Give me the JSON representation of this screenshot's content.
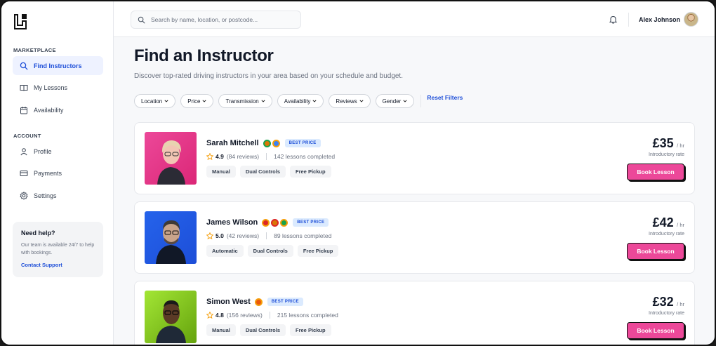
{
  "sidebar": {
    "sections": [
      {
        "label": "MARKETPLACE"
      },
      {
        "label": "ACCOUNT"
      }
    ],
    "items": [
      {
        "label": "Find Instructors",
        "icon": "search-icon",
        "active": true
      },
      {
        "label": "My Lessons",
        "icon": "book-icon"
      },
      {
        "label": "Availability",
        "icon": "calendar-icon"
      },
      {
        "label": "Profile",
        "icon": "user-icon"
      },
      {
        "label": "Payments",
        "icon": "credit-card-icon"
      },
      {
        "label": "Settings",
        "icon": "gear-icon"
      }
    ],
    "help": {
      "title": "Need help?",
      "text": "Our team is available 24/7 to help with bookings.",
      "link": "Contact Support"
    }
  },
  "topbar": {
    "search_placeholder": "Search by name, location, or postcode...",
    "user_name": "Alex Johnson"
  },
  "main": {
    "title": "Find an Instructor",
    "subtitle": "Discover top-rated driving instructors in your area based on your schedule and budget.",
    "filters": [
      "Location",
      "Price",
      "Transmission",
      "Availability",
      "Reviews",
      "Gender"
    ],
    "reset_label": "Reset Filters"
  },
  "instructors": [
    {
      "name": "Sarah Mitchell",
      "badge": "BEST PRICE",
      "rating": "4.9",
      "reviews": "(84 reviews)",
      "lessons": "142 lessons completed",
      "tags": [
        "Manual",
        "Dual Controls",
        "Free Pickup"
      ],
      "price": "£35",
      "unit": "/ hr",
      "price_note": "Introductory rate",
      "book_label": "Book Lesson"
    },
    {
      "name": "James Wilson",
      "badge": "BEST PRICE",
      "rating": "5.0",
      "reviews": "(42 reviews)",
      "lessons": "89 lessons completed",
      "tags": [
        "Automatic",
        "Dual Controls",
        "Free Pickup"
      ],
      "price": "£42",
      "unit": "/ hr",
      "price_note": "Introductory rate",
      "book_label": "Book Lesson"
    },
    {
      "name": "Simon West",
      "badge": "BEST PRICE",
      "rating": "4.8",
      "reviews": "(156 reviews)",
      "lessons": "215 lessons completed",
      "tags": [
        "Manual",
        "Dual Controls",
        "Free Pickup"
      ],
      "price": "£32",
      "unit": "/ hr",
      "price_note": "Introductory rate",
      "book_label": "Book Lesson"
    }
  ],
  "colors": {
    "accent": "#1d4ed8",
    "book_button": "#ec4899",
    "badge_bg": "#dbeafe"
  }
}
